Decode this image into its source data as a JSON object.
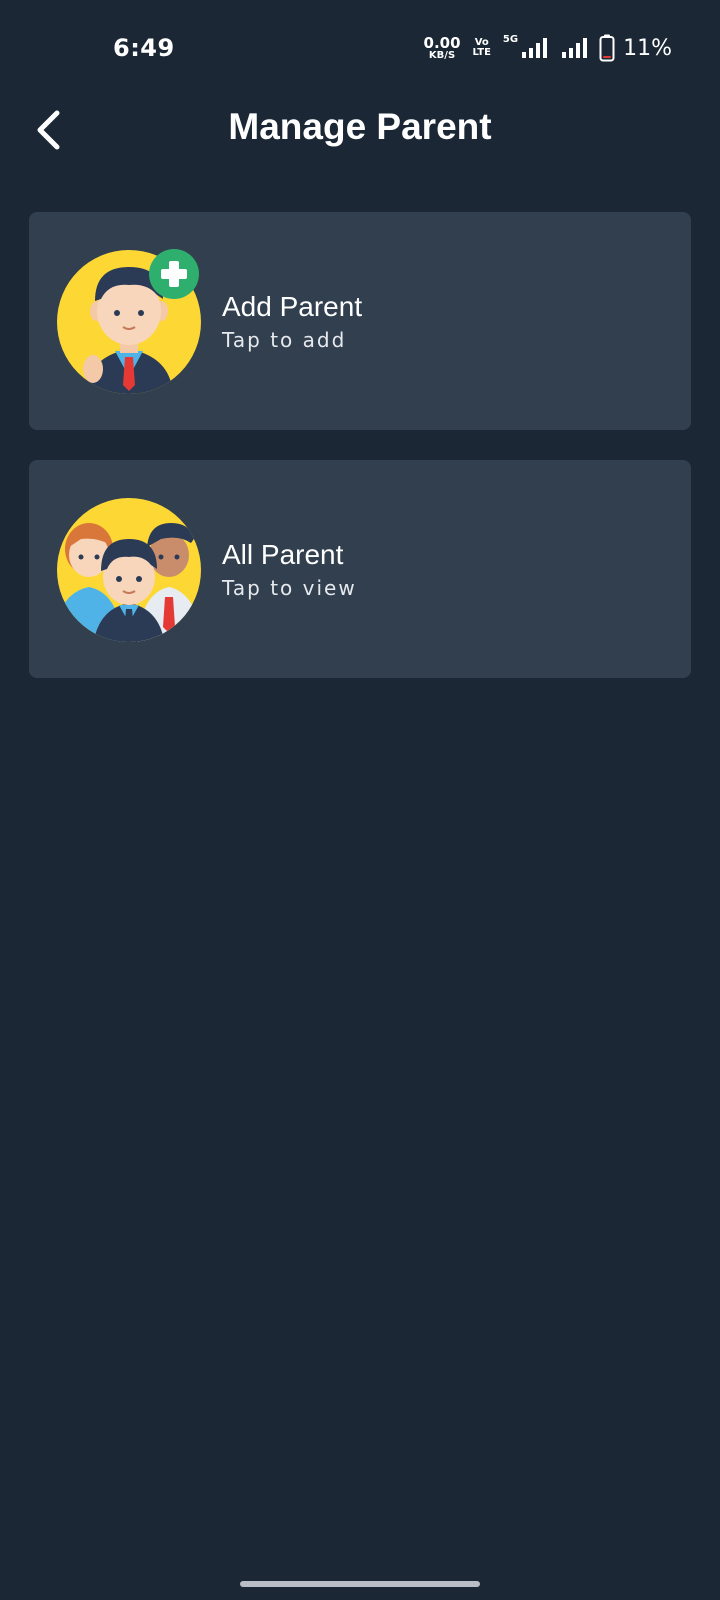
{
  "status_bar": {
    "time": "6:49",
    "net_speed_value": "0.00",
    "net_speed_unit": "KB/S",
    "volte_top": "Vo",
    "volte_bottom": "LTE",
    "network_type": "5G",
    "battery_percent": "11%",
    "battery_level": 0.11,
    "battery_low_color": "#e53935"
  },
  "header": {
    "title": "Manage Parent",
    "back_icon": "chevron-left-icon"
  },
  "cards": [
    {
      "title": "Add Parent",
      "subtitle": "Tap to add",
      "icon": "add-parent-avatar-icon"
    },
    {
      "title": "All Parent",
      "subtitle": "Tap to view",
      "icon": "parents-group-icon"
    }
  ],
  "colors": {
    "background": "#1b2735",
    "card": "#323f4e",
    "avatar_bg": "#fdd835",
    "add_badge": "#2eaf6d",
    "tie": "#e53935"
  }
}
